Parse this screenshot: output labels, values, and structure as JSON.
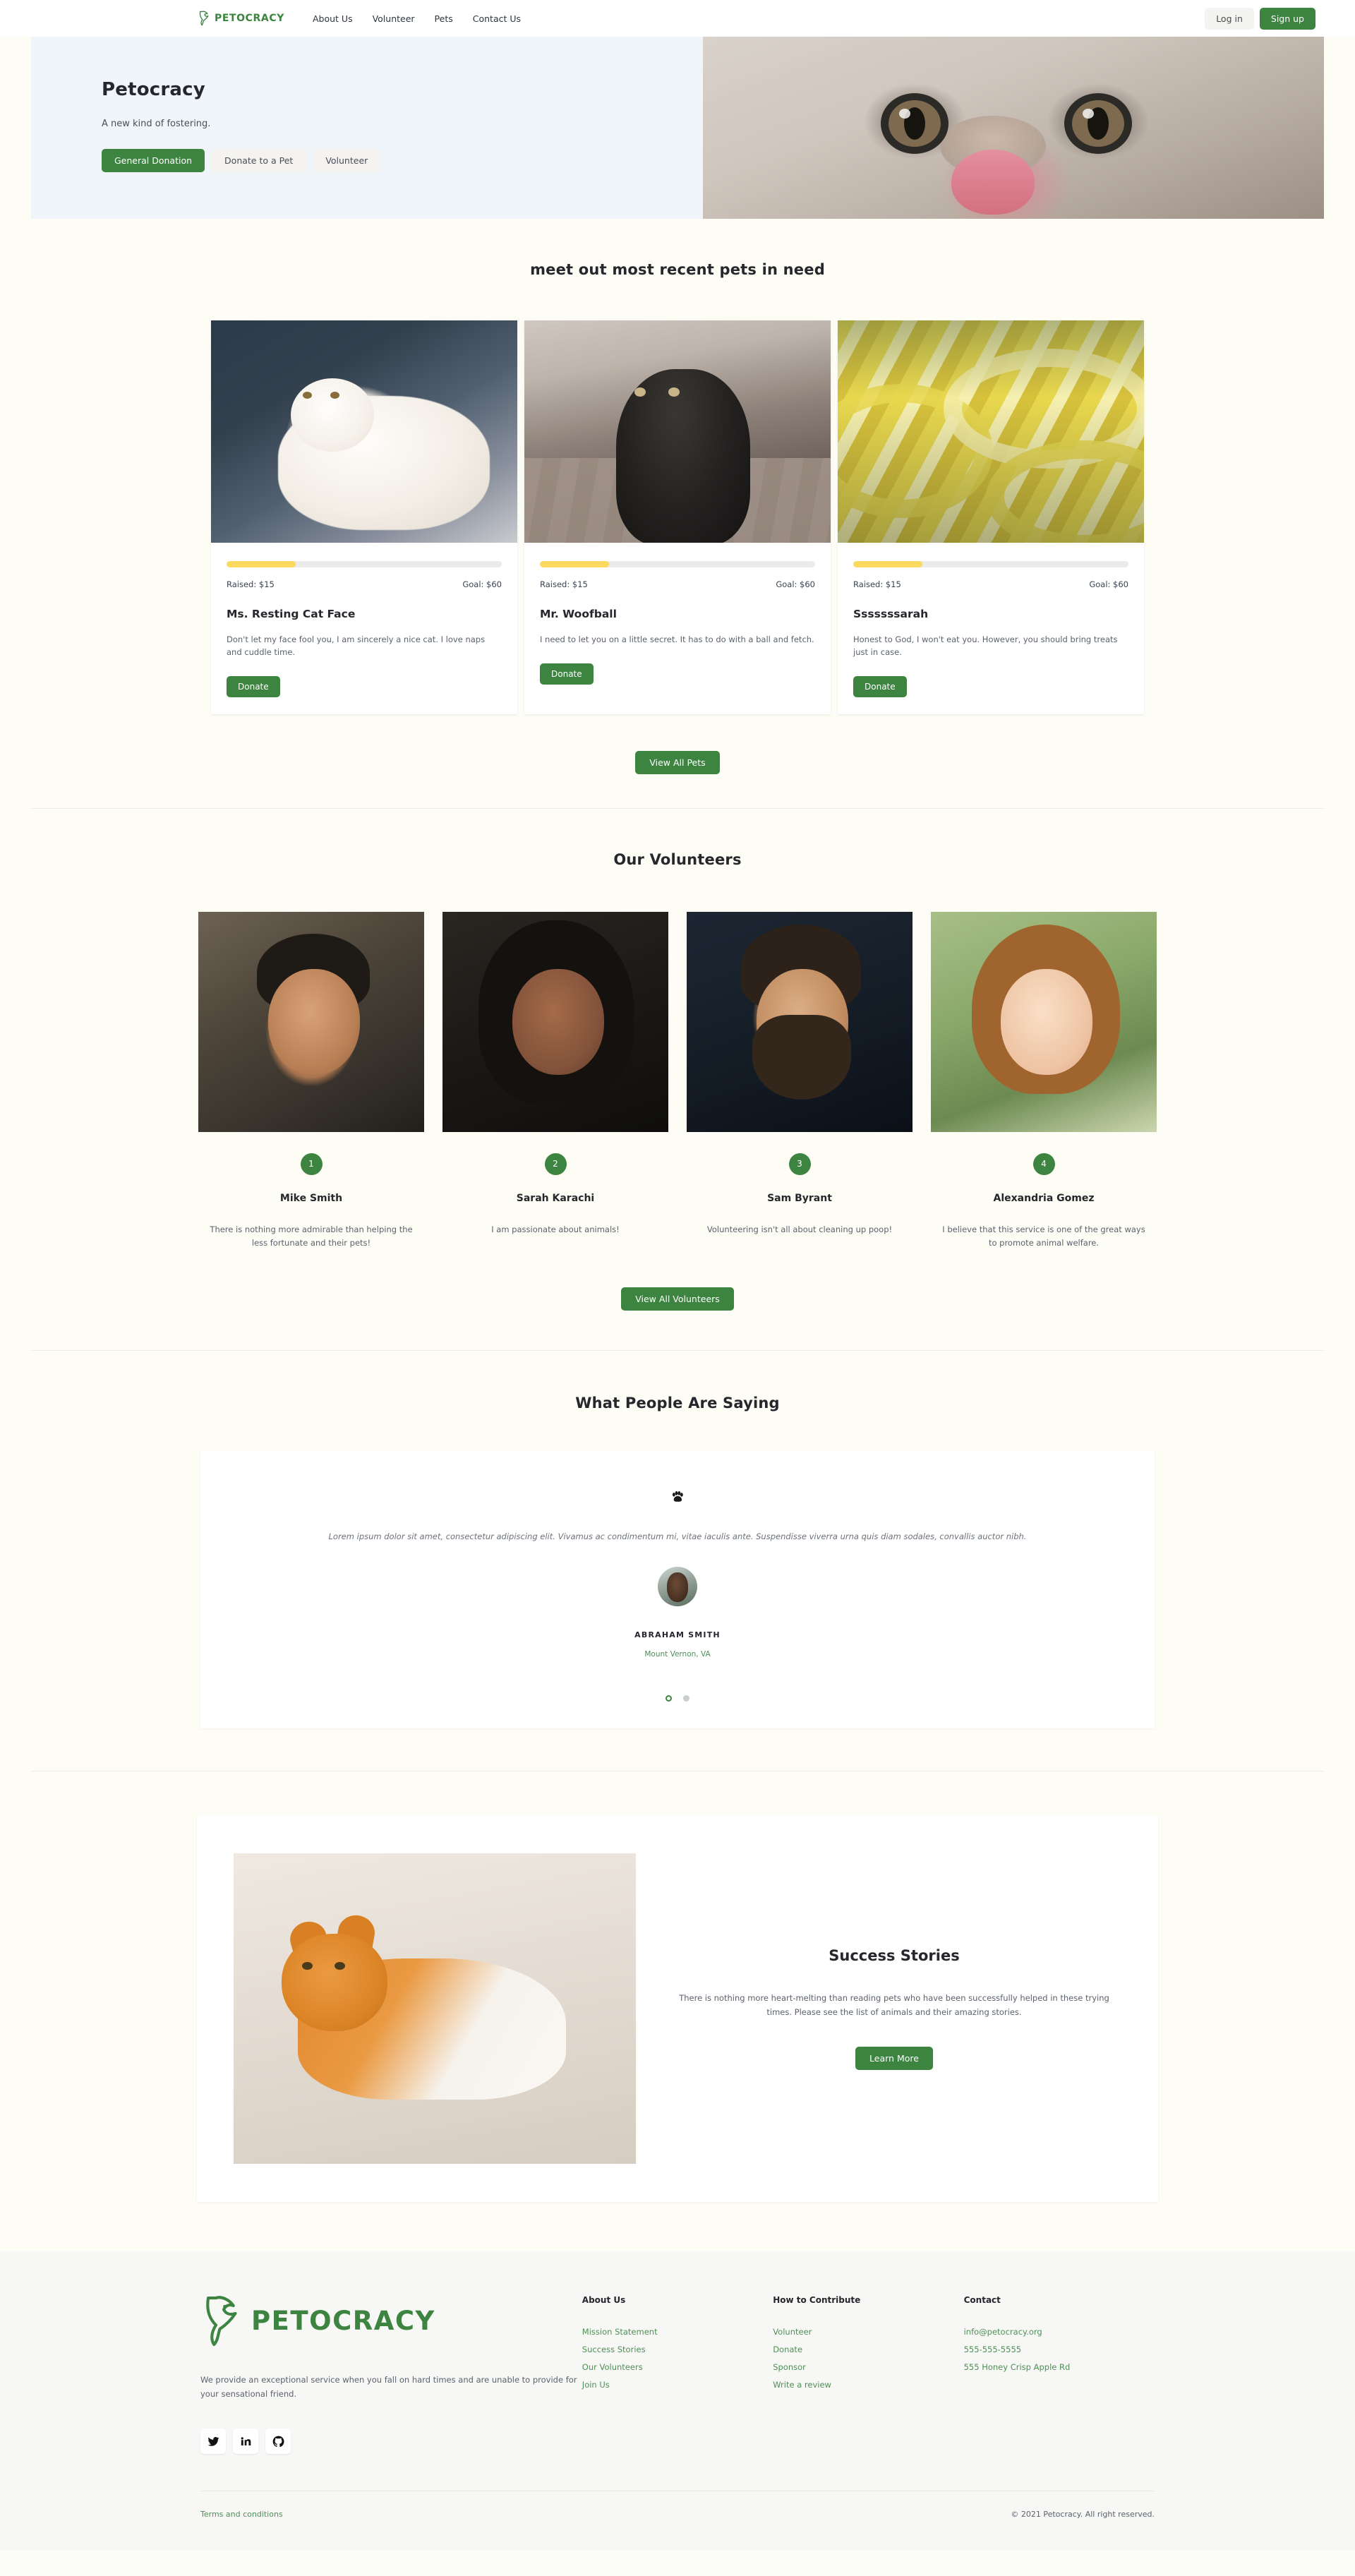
{
  "brand": {
    "name": "PETOCRACY",
    "color": "#3c8440"
  },
  "nav": {
    "links": [
      "About Us",
      "Volunteer",
      "Pets",
      "Contact Us"
    ],
    "login_label": "Log in",
    "signup_label": "Sign up"
  },
  "hero": {
    "title": "Petocracy",
    "subtitle": "A new kind of fostering.",
    "buttons": [
      "General Donation",
      "Donate to a Pet",
      "Volunteer"
    ]
  },
  "pets_section": {
    "title": "meet out most recent pets in need",
    "view_all_label": "View All Pets",
    "raised_label": "Raised: $15",
    "goal_label": "Goal: $60",
    "donate_label": "Donate",
    "progress_percent": 25,
    "cards": [
      {
        "name": "Ms. Resting Cat Face",
        "description": "Don't let my face fool you, I am sincerely a nice cat. I love naps and cuddle time.",
        "raised": "Raised: $15",
        "goal": "Goal: $60",
        "donate": "Donate",
        "photo": "white-cat-photo"
      },
      {
        "name": "Mr. Woofball",
        "description": "I need to let you on a little secret. It has to do with a ball and fetch.",
        "raised": "Raised: $15",
        "goal": "Goal: $60",
        "donate": "Donate",
        "photo": "black-dog-photo"
      },
      {
        "name": "Sssssssarah",
        "description": "Honest to God, I won't eat you. However, you should bring treats just in case.",
        "raised": "Raised: $15",
        "goal": "Goal: $60",
        "donate": "Donate",
        "photo": "yellow-snake-photo"
      }
    ]
  },
  "volunteers_section": {
    "title": "Our Volunteers",
    "view_all_label": "View All Volunteers",
    "cards": [
      {
        "number": "1",
        "name": "Mike Smith",
        "quote": "There is nothing more admirable than helping the less fortunate and their pets!"
      },
      {
        "number": "2",
        "name": "Sarah Karachi",
        "quote": "I am passionate about animals!"
      },
      {
        "number": "3",
        "name": "Sam Byrant",
        "quote": "Volunteering isn't all about cleaning up poop!"
      },
      {
        "number": "4",
        "name": "Alexandria Gomez",
        "quote": "I believe that this service is one of the great ways to promote animal welfare."
      }
    ]
  },
  "testimonial_section": {
    "title": "What People Are Saying",
    "quote": "Lorem ipsum dolor sit amet, consectetur adipiscing elit. Vivamus ac condimentum mi, vitae iaculis ante. Suspendisse viverra urna quis diam sodales, convallis auctor nibh.",
    "author": "ABRAHAM SMITH",
    "location": "Mount Vernon, VA",
    "dots": 2,
    "active_dot": 1
  },
  "success_section": {
    "title": "Success Stories",
    "description": "There is nothing more heart-melting than reading pets who have been successfully helped in these trying times. Please see the list of animals and their amazing stories.",
    "button_label": "Learn More"
  },
  "footer": {
    "logo_text": "PETOCRACY",
    "description": "We provide an exceptional service when you fall on hard times and are unable to provide for your sensational friend.",
    "socials": [
      "twitter-icon",
      "linkedin-icon",
      "github-icon"
    ],
    "columns": [
      {
        "heading": "About Us",
        "items": [
          "Mission Statement",
          "Success Stories",
          "Our Volunteers",
          "Join Us"
        ]
      },
      {
        "heading": "How to Contribute",
        "items": [
          "Volunteer",
          "Donate",
          "Sponsor",
          "Write a review"
        ]
      },
      {
        "heading": "Contact",
        "items": [
          "info@petocracy.org",
          "555-555-5555",
          "555 Honey Crisp Apple Rd"
        ]
      }
    ],
    "terms_label": "Terms and conditions",
    "copyright": "© 2021 Petocracy. All right reserved."
  }
}
